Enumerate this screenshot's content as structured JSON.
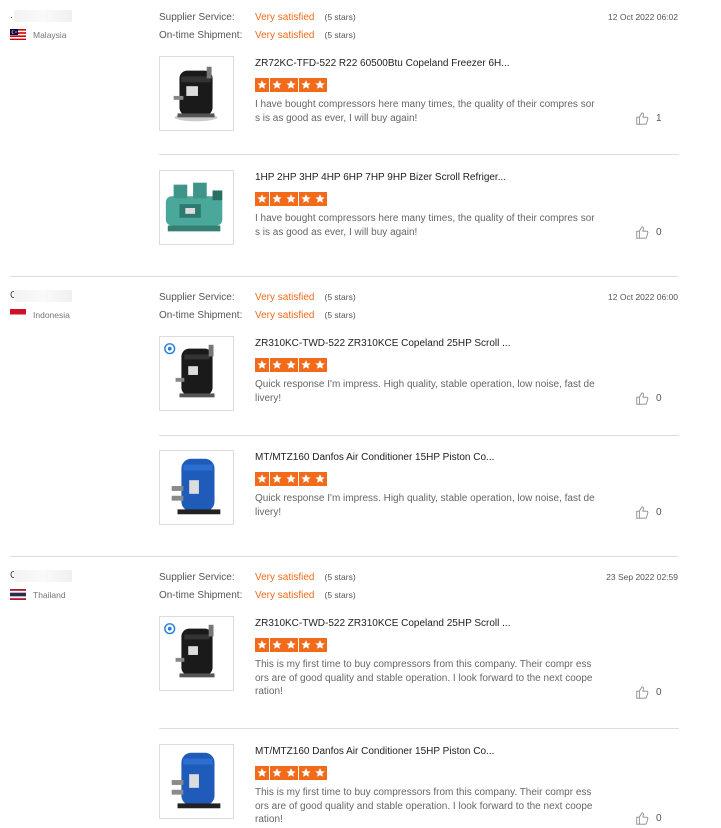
{
  "reviews": [
    {
      "buyer": ".",
      "country": "Malaysia",
      "date": "12 Oct 2022 06:02",
      "supplier_service_label": "Supplier Service:",
      "supplier_service_value": "Very satisfied",
      "supplier_service_stars": "(5 stars)",
      "shipment_label": "On-time Shipment:",
      "shipment_value": "Very satisfied",
      "shipment_stars": "(5 stars)",
      "products": [
        {
          "title": "ZR72KC-TFD-522 R22 60500Btu Copeland Freezer 6H...",
          "rating": 5,
          "comment": "I have bought compressors here many times, the quality of their compres sors is as good as ever, I will buy again!",
          "likes": "1",
          "image": "black-scroll-compressor"
        },
        {
          "title": "1HP 2HP 3HP 4HP 6HP 7HP 9HP Bizer Scroll Refriger...",
          "rating": 5,
          "comment": "I have bought compressors here many times, the quality of their compres sors is as good as ever, I will buy again!",
          "likes": "0",
          "image": "green-piston-compressor"
        }
      ]
    },
    {
      "buyer": "C",
      "country": "Indonesia",
      "date": "12 Oct 2022 06:00",
      "supplier_service_label": "Supplier Service:",
      "supplier_service_value": "Very satisfied",
      "supplier_service_stars": "(5 stars)",
      "shipment_label": "On-time Shipment:",
      "shipment_value": "Very satisfied",
      "shipment_stars": "(5 stars)",
      "products": [
        {
          "title": "ZR310KC-TWD-522 ZR310KCE Copeland 25HP Scroll ...",
          "rating": 5,
          "comment": "Quick response I'm impress. High quality, stable operation, low noise, fast delivery!",
          "likes": "0",
          "image": "black-scroll-compressor-badge"
        },
        {
          "title": "MT/MTZ160 Danfos Air Conditioner 15HP Piston Co...",
          "rating": 5,
          "comment": "Quick response I'm impress. High quality, stable operation, low noise, fast delivery!",
          "likes": "0",
          "image": "blue-compressor"
        }
      ]
    },
    {
      "buyer": "C",
      "country": "Thailand",
      "date": "23 Sep 2022 02:59",
      "supplier_service_label": "Supplier Service:",
      "supplier_service_value": "Very satisfied",
      "supplier_service_stars": "(5 stars)",
      "shipment_label": "On-time Shipment:",
      "shipment_value": "Very satisfied",
      "shipment_stars": "(5 stars)",
      "products": [
        {
          "title": "ZR310KC-TWD-522 ZR310KCE Copeland 25HP Scroll ...",
          "rating": 5,
          "comment": "This is my first time to buy compressors from this company. Their compr essors are of good quality and stable operation. I look forward to the next cooperation!",
          "likes": "0",
          "image": "black-scroll-compressor-badge"
        },
        {
          "title": "MT/MTZ160 Danfos Air Conditioner 15HP Piston Co...",
          "rating": 5,
          "comment": "This is my first time to buy compressors from this company. Their compr essors are of good quality and stable operation. I look forward to the next cooperation!",
          "likes": "0",
          "image": "blue-compressor"
        }
      ]
    }
  ],
  "colors": {
    "accent": "#f26b1b",
    "divider": "#dddddd"
  },
  "icons": {
    "like": "thumbs-up-icon",
    "star": "star-icon"
  }
}
